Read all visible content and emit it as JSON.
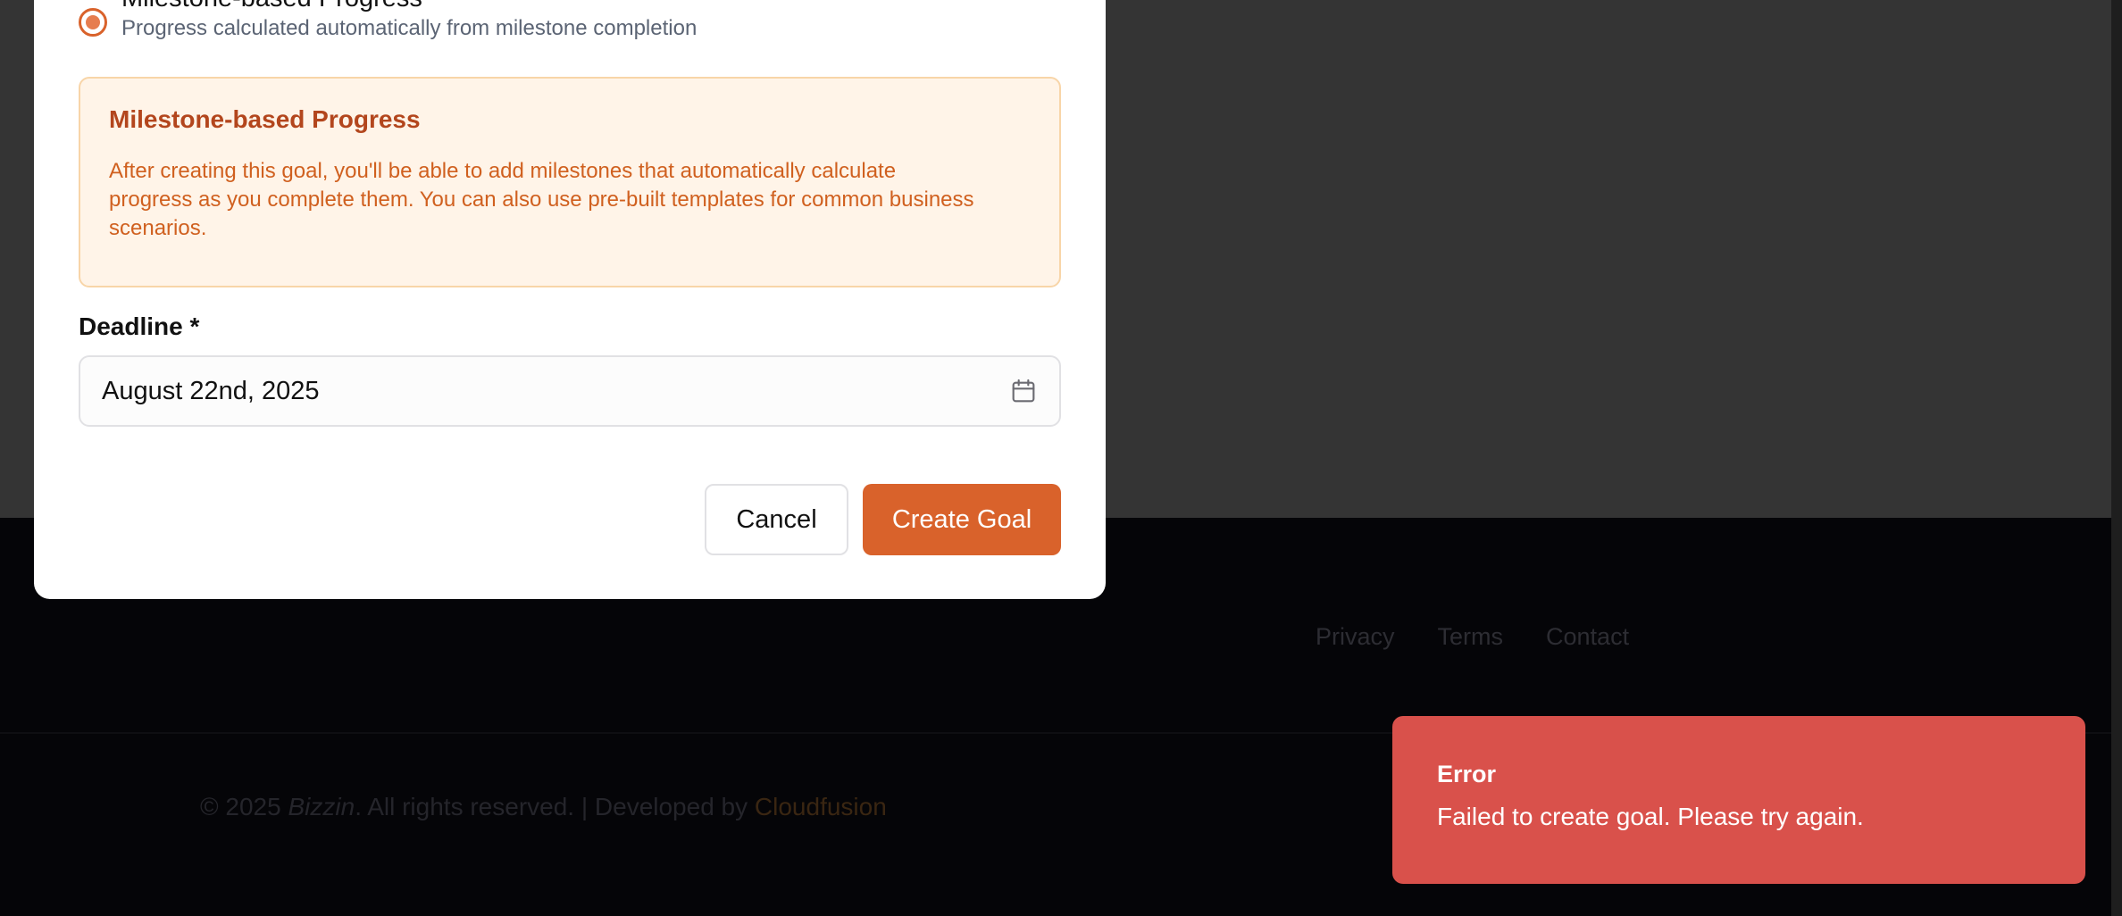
{
  "progress_option": {
    "title": "Milestone-based Progress",
    "description": "Progress calculated automatically from milestone completion"
  },
  "info_box": {
    "title": "Milestone-based Progress",
    "text": "After creating this goal, you'll be able to add milestones that automatically calculate progress as you complete them. You can also use pre-built templates for common business scenarios."
  },
  "deadline": {
    "label": "Deadline *",
    "value": "August 22nd, 2025",
    "icon": "calendar-icon"
  },
  "actions": {
    "cancel_label": "Cancel",
    "create_label": "Create Goal"
  },
  "footer": {
    "links": [
      "Privacy",
      "Terms",
      "Contact"
    ],
    "copyright_prefix": "© 2025 ",
    "brand": "Bizzin",
    "copyright_suffix": ". All rights reserved. | Developed by ",
    "developer": "Cloudfusion"
  },
  "toast": {
    "title": "Error",
    "message": "Failed to create goal. Please try again."
  },
  "colors": {
    "accent": "#d9622b",
    "error": "#d9514b",
    "info_bg": "#fff4e8",
    "info_text": "#d0601f"
  }
}
